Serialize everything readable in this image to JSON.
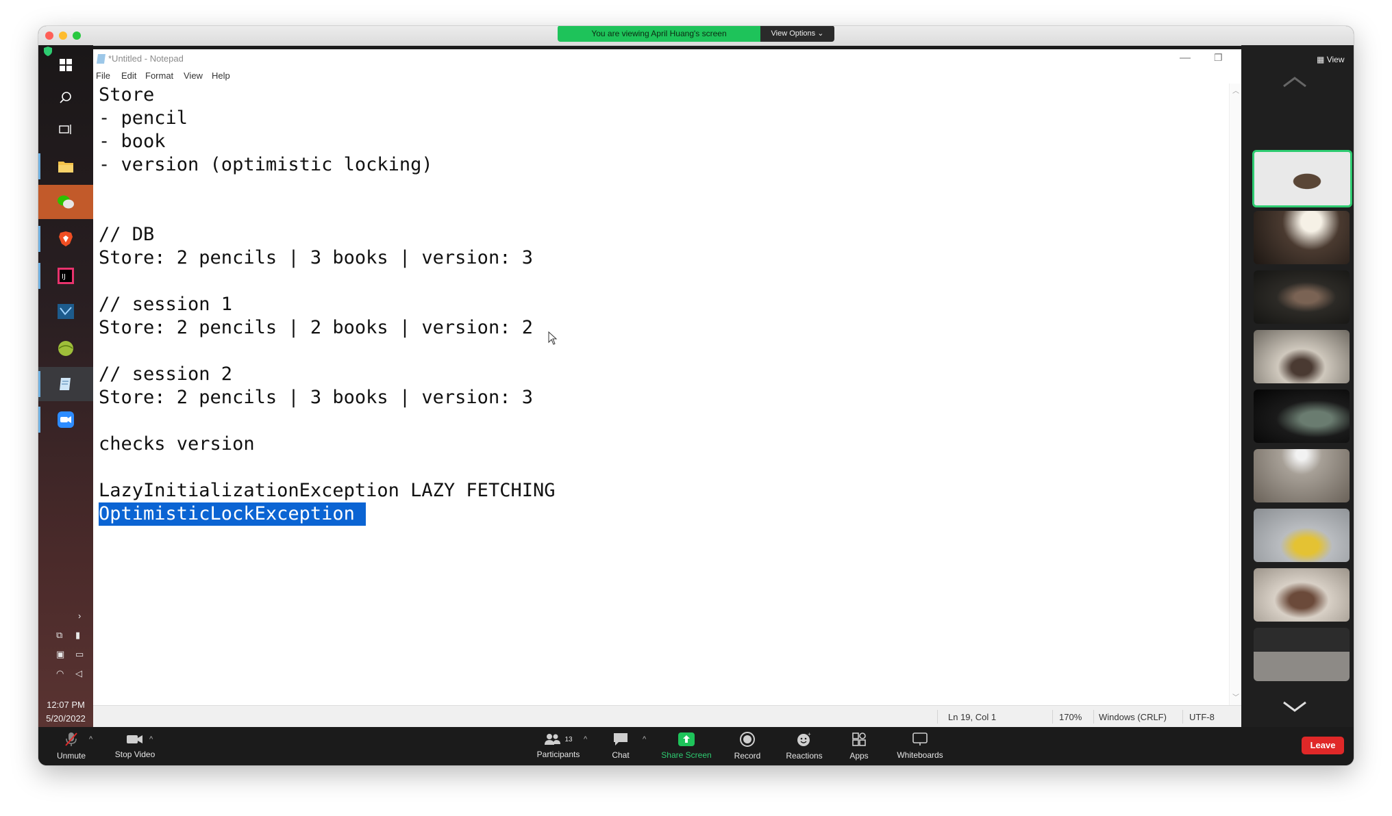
{
  "banner": {
    "text": "You are viewing April Huang's screen",
    "options_label": "View Options"
  },
  "notepad": {
    "title": "*Untitled - Notepad",
    "menu": [
      "File",
      "Edit",
      "Format",
      "View",
      "Help"
    ],
    "lines": [
      "Store",
      "- pencil",
      "- book",
      "- version (optimistic locking)",
      "",
      "",
      "// DB",
      "Store: 2 pencils | 3 books | version: 3",
      "",
      "// session 1",
      "Store: 2 pencils | 2 books | version: 2",
      "",
      "// session 2",
      "Store: 2 pencils | 3 books | version: 3",
      "",
      "checks version",
      "",
      "LazyInitializationException LAZY FETCHING"
    ],
    "selected_line": "OptimisticLockException",
    "status": {
      "position": "Ln 19, Col 1",
      "zoom": "170%",
      "line_ending": "Windows (CRLF)",
      "encoding": "UTF-8"
    }
  },
  "taskbar": {
    "time": "12:07 PM",
    "date": "5/20/2022"
  },
  "right_panel": {
    "view_label": "View"
  },
  "toolbar": {
    "unmute": "Unmute",
    "stop_video": "Stop Video",
    "participants": "Participants",
    "participants_count": "13",
    "chat": "Chat",
    "share_screen": "Share Screen",
    "record": "Record",
    "reactions": "Reactions",
    "apps": "Apps",
    "whiteboards": "Whiteboards",
    "leave": "Leave"
  },
  "colors": {
    "share_green": "#1ec35a",
    "leave_red": "#e02828",
    "selection_blue": "#0b64d3",
    "active_speaker_border": "#2ecc71"
  }
}
